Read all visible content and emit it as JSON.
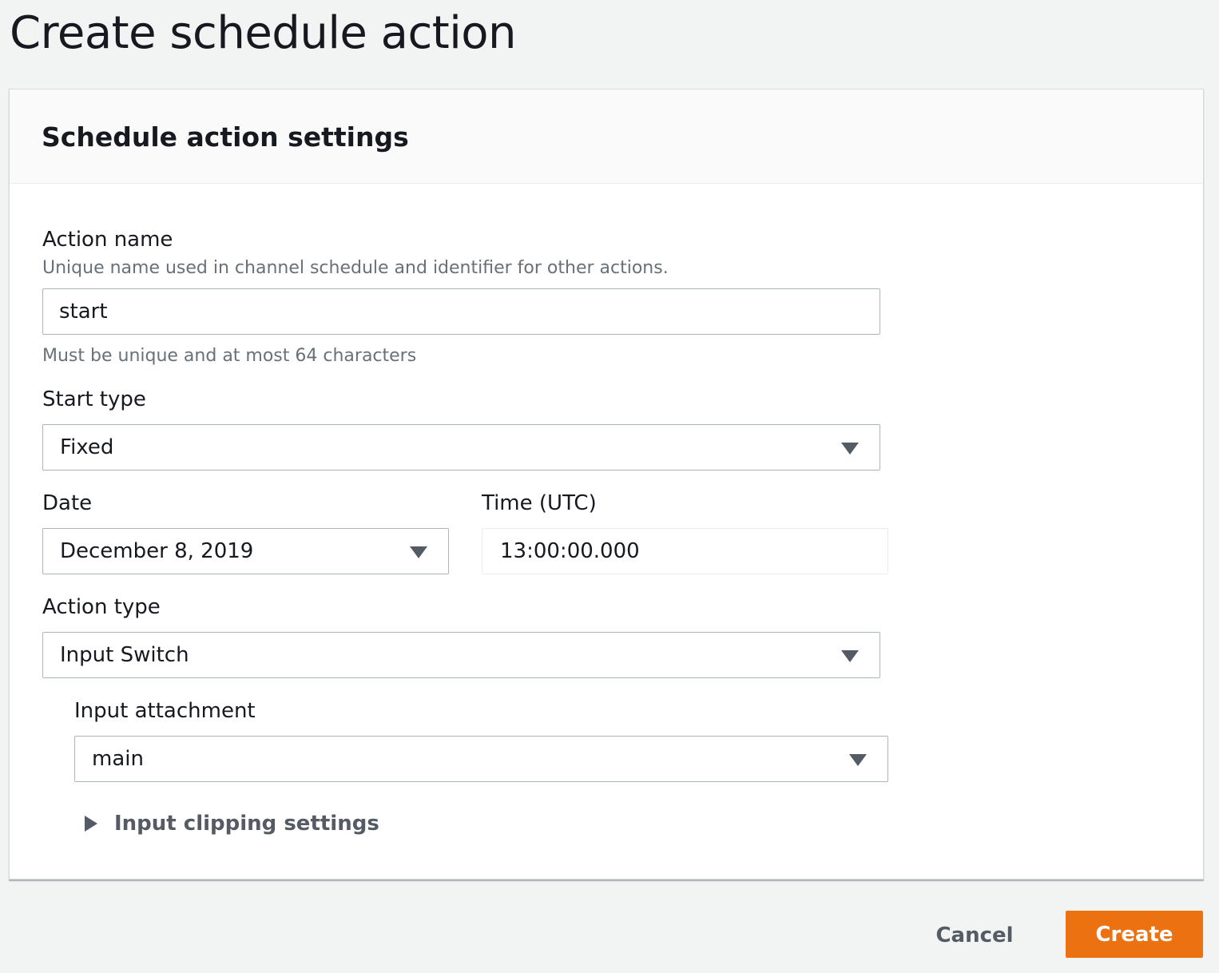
{
  "page": {
    "title": "Create schedule action"
  },
  "panel": {
    "title": "Schedule action settings"
  },
  "action_name": {
    "label": "Action name",
    "description": "Unique name used in channel schedule and identifier for other actions.",
    "value": "start",
    "constraint": "Must be unique and at most 64 characters"
  },
  "start_type": {
    "label": "Start type",
    "value": "Fixed"
  },
  "date": {
    "label": "Date",
    "value": "December 8, 2019"
  },
  "time": {
    "label": "Time (UTC)",
    "value": "13:00:00.000"
  },
  "action_type": {
    "label": "Action type",
    "value": "Input Switch"
  },
  "input_attachment": {
    "label": "Input attachment",
    "value": "main"
  },
  "input_clipping": {
    "label": "Input clipping settings"
  },
  "footer": {
    "cancel_label": "Cancel",
    "create_label": "Create"
  },
  "colors": {
    "background": "#f2f3f3",
    "primary_button": "#ec7211",
    "text": "#16191f",
    "secondary_text": "#687078",
    "border": "#aab7b8"
  }
}
